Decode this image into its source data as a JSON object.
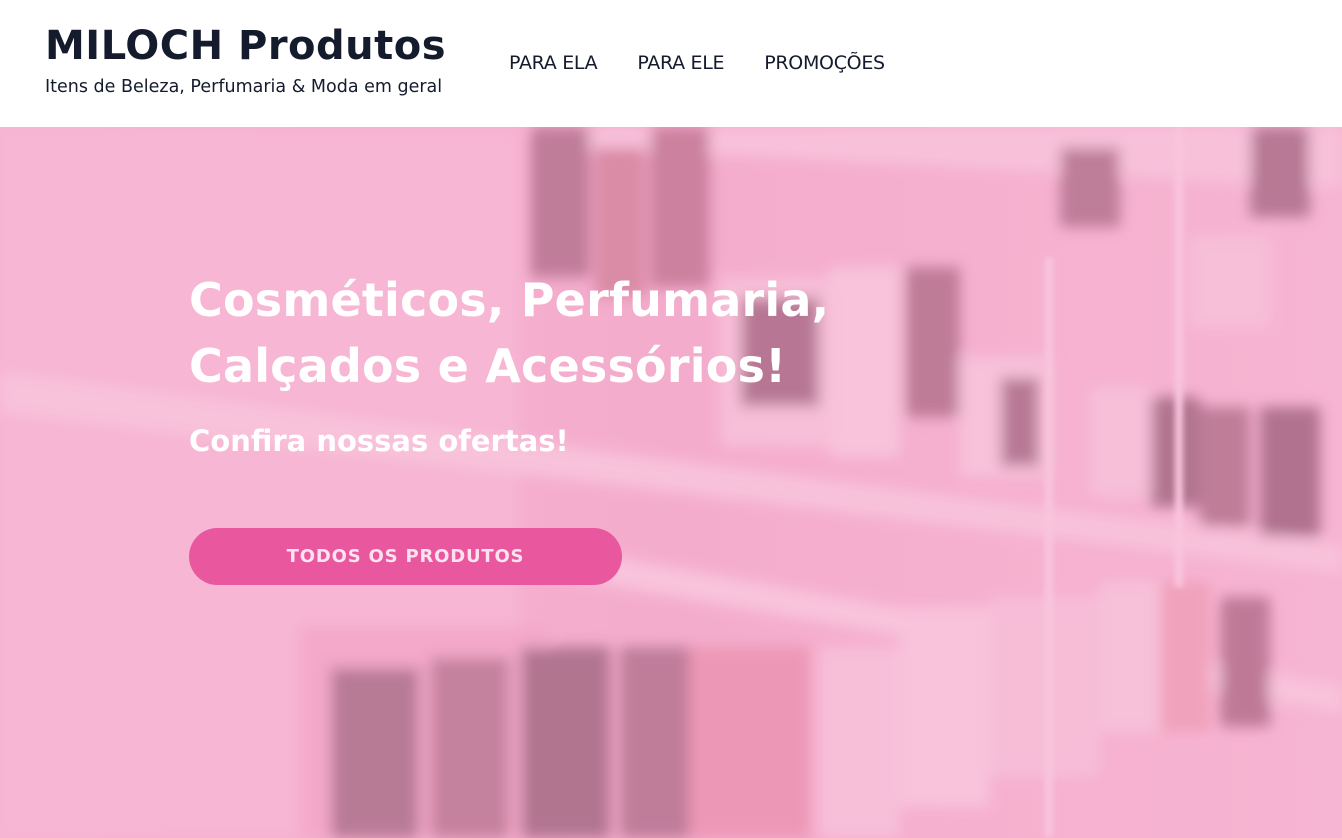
{
  "header": {
    "title": "MILOCH Produtos",
    "tagline": "Itens de Beleza, Perfumaria & Moda em geral",
    "nav": [
      {
        "label": "PARA ELA"
      },
      {
        "label": "PARA ELE"
      },
      {
        "label": "PROMOÇÕES"
      }
    ]
  },
  "hero": {
    "title_line1": "Cosméticos, Perfumaria,",
    "title_line2": "Calçados e Acessórios!",
    "subtitle": "Confira nossas ofertas!",
    "button_label": "TODOS OS PRODUTOS",
    "background_image": "blurred-store-shelves-image"
  },
  "colors": {
    "text_dark": "#141b2d",
    "hero_overlay": "#f6a8cb",
    "button": "#e9579f",
    "hero_text": "#ffffff"
  }
}
